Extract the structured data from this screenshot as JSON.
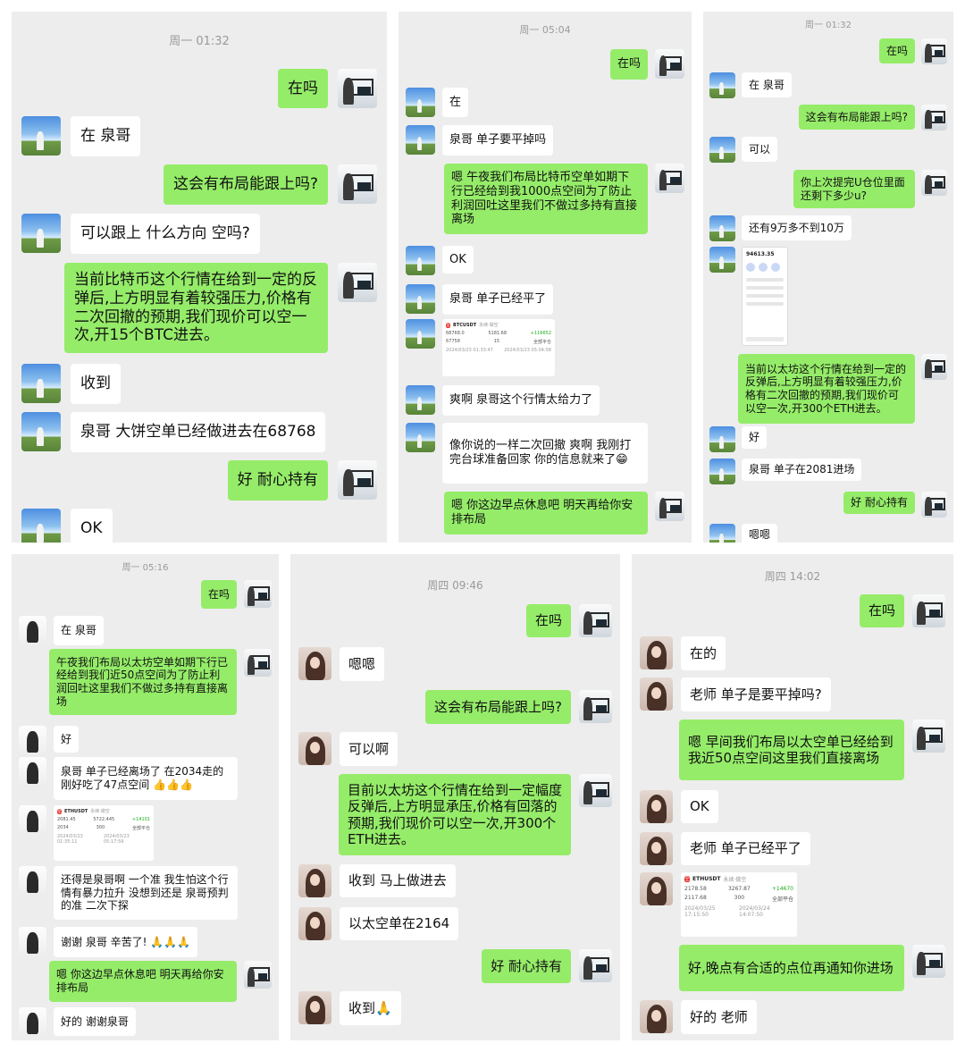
{
  "panels": [
    {
      "timestamp": "周一 01:32",
      "messages": [
        {
          "side": "out",
          "avatar": "me",
          "text": "在吗"
        },
        {
          "side": "in",
          "avatar": "sky",
          "text": "在 泉哥"
        },
        {
          "side": "out",
          "avatar": "me",
          "text": "这会有布局能跟上吗?"
        },
        {
          "side": "in",
          "avatar": "sky",
          "text": "可以跟上 什么方向 空吗?"
        },
        {
          "side": "out",
          "avatar": "me",
          "text": "当前比特币这个行情在给到一定的反弹后,上方明显有着较强压力,价格有二次回撤的预期,我们现价可以空一次,开15个BTC进去。"
        },
        {
          "side": "in",
          "avatar": "sky",
          "text": "收到"
        },
        {
          "side": "in",
          "avatar": "sky",
          "text": "泉哥 大饼空单已经做进去在68768"
        },
        {
          "side": "out",
          "avatar": "me",
          "text": "好 耐心持有"
        },
        {
          "side": "in",
          "avatar": "sky",
          "text": "OK"
        }
      ]
    },
    {
      "timestamp": "周一 05:04",
      "messages": [
        {
          "side": "out",
          "avatar": "me",
          "text": "在吗"
        },
        {
          "side": "in",
          "avatar": "sky",
          "text": "在"
        },
        {
          "side": "in",
          "avatar": "sky",
          "text": "泉哥 单子要平掉吗"
        },
        {
          "side": "out",
          "avatar": "me",
          "text": "嗯 午夜我们布局比特币空单如期下行已经给到我1000点空间为了防止利润回吐这里我们不做过多持有直接离场"
        },
        {
          "side": "in",
          "avatar": "sky",
          "text": "OK"
        },
        {
          "side": "in",
          "avatar": "sky",
          "text": "泉哥 单子已经平了"
        },
        {
          "side": "in",
          "avatar": "sky",
          "kind": "card",
          "card": {
            "badge": "空",
            "pair": "BTCUSDT",
            "tag": "永续·做空",
            "c1": "68768.0",
            "c2": "5181.68",
            "c3": "+116652",
            "c4": "67758",
            "c5": "15",
            "c6": "全部平仓",
            "t1": "2024/03/23 01:33:47",
            "t2": "2024/03/23 05:04:58"
          }
        },
        {
          "side": "in",
          "avatar": "sky",
          "text": "爽啊 泉哥这个行情太给力了"
        },
        {
          "side": "in",
          "avatar": "sky",
          "text": "像你说的一样二次回撤 爽啊 我刚打完台球准备回家 你的信息就来了😁"
        },
        {
          "side": "out",
          "avatar": "me",
          "text": "嗯 你这边早点休息吧 明天再给你安排布局"
        }
      ]
    },
    {
      "timestamp": "周一 01:32",
      "messages": [
        {
          "side": "out",
          "avatar": "me",
          "text": "在吗"
        },
        {
          "side": "in",
          "avatar": "sky",
          "text": "在 泉哥"
        },
        {
          "side": "out",
          "avatar": "me",
          "text": "这会有布局能跟上吗?"
        },
        {
          "side": "in",
          "avatar": "sky",
          "text": "可以"
        },
        {
          "side": "out",
          "avatar": "me",
          "text": "你上次提完U仓位里面还剩下多少u?"
        },
        {
          "side": "in",
          "avatar": "sky",
          "text": "还有9万多不到10万"
        },
        {
          "side": "in",
          "avatar": "sky",
          "kind": "phone",
          "phone": {
            "amount": "94613.35"
          }
        },
        {
          "side": "out",
          "avatar": "me",
          "text": "当前以太坊这个行情在给到一定的反弹后,上方明显有着较强压力,价格有二次回撤的预期,我们现价可以空一次,开300个ETH进去。"
        },
        {
          "side": "in",
          "avatar": "sky",
          "text": "好"
        },
        {
          "side": "in",
          "avatar": "sky",
          "text": "泉哥 单子在2081进场"
        },
        {
          "side": "out",
          "avatar": "me",
          "text": "好 耐心持有"
        },
        {
          "side": "in",
          "avatar": "sky",
          "text": "嗯嗯"
        }
      ]
    },
    {
      "timestamp": "周一 05:16",
      "messages": [
        {
          "side": "out",
          "avatar": "me",
          "text": "在吗"
        },
        {
          "side": "in",
          "avatar": "guy",
          "text": "在 泉哥"
        },
        {
          "side": "out",
          "avatar": "me",
          "text": "午夜我们布局以太坊空单如期下行已经给到我们近50点空间为了防止利润回吐这里我们不做过多持有直接离场"
        },
        {
          "side": "in",
          "avatar": "guy",
          "text": "好"
        },
        {
          "side": "in",
          "avatar": "guy",
          "text": "泉哥 单子已经离场了 在2034走的 刚好吃了47点空间 👍👍👍"
        },
        {
          "side": "in",
          "avatar": "guy",
          "kind": "card",
          "card": {
            "badge": "空",
            "pair": "ETHUSDT",
            "tag": "永续·做空",
            "c1": "2081.45",
            "c2": "5722.445",
            "c3": "+14101",
            "c4": "2034",
            "c5": "300",
            "c6": "全部平仓",
            "t1": "2024/03/23 01:35:11",
            "t2": "2024/03/23 05:17:59"
          }
        },
        {
          "side": "in",
          "avatar": "guy",
          "text": "还得是泉哥啊 一个准 我生怕这个行情有暴力拉升 没想到还是 泉哥预判的准 二次下探"
        },
        {
          "side": "in",
          "avatar": "guy",
          "text": "谢谢 泉哥 辛苦了! 🙏🙏🙏"
        },
        {
          "side": "out",
          "avatar": "me",
          "text": "嗯 你这边早点休息吧 明天再给你安排布局"
        },
        {
          "side": "in",
          "avatar": "guy",
          "text": "好的 谢谢泉哥"
        }
      ]
    },
    {
      "timestamp": "周四 09:46",
      "messages": [
        {
          "side": "out",
          "avatar": "me",
          "text": "在吗"
        },
        {
          "side": "in",
          "avatar": "girl",
          "text": "嗯嗯"
        },
        {
          "side": "out",
          "avatar": "me",
          "text": "这会有布局能跟上吗?"
        },
        {
          "side": "in",
          "avatar": "girl",
          "text": "可以啊"
        },
        {
          "side": "out",
          "avatar": "me",
          "text": "目前以太坊这个行情在给到一定幅度反弹后,上方明显承压,价格有回落的预期,我们现价可以空一次,开300个ETH进去。"
        },
        {
          "side": "in",
          "avatar": "girl",
          "text": "收到 马上做进去"
        },
        {
          "side": "in",
          "avatar": "girl",
          "text": "以太空单在2164"
        },
        {
          "side": "out",
          "avatar": "me",
          "text": "好 耐心持有"
        },
        {
          "side": "in",
          "avatar": "girl",
          "text": "收到🙏"
        }
      ]
    },
    {
      "timestamp": "周四 14:02",
      "messages": [
        {
          "side": "out",
          "avatar": "me",
          "text": "在吗"
        },
        {
          "side": "in",
          "avatar": "girl",
          "text": "在的"
        },
        {
          "side": "in",
          "avatar": "girl",
          "text": "老师 单子是要平掉吗?"
        },
        {
          "side": "out",
          "avatar": "me",
          "text": "嗯 早间我们布局以太空单已经给到我近50点空间这里我们直接离场"
        },
        {
          "side": "in",
          "avatar": "girl",
          "text": "OK"
        },
        {
          "side": "in",
          "avatar": "girl",
          "text": "老师 单子已经平了"
        },
        {
          "side": "in",
          "avatar": "girl",
          "kind": "card",
          "card": {
            "badge": "空",
            "pair": "ETHUSDT",
            "tag": "永续·做空",
            "c1": "2178.58",
            "c2": "3267.87",
            "c3": "+14670",
            "c4": "2117.68",
            "c5": "300",
            "c6": "全部平仓",
            "t1": "2024/03/25 17:15:50",
            "t2": "2024/03/24 14:07:50"
          }
        },
        {
          "side": "out",
          "avatar": "me",
          "text": "好,晚点有合适的点位再通知你进场"
        },
        {
          "side": "in",
          "avatar": "girl",
          "text": "好的 老师"
        }
      ]
    }
  ]
}
